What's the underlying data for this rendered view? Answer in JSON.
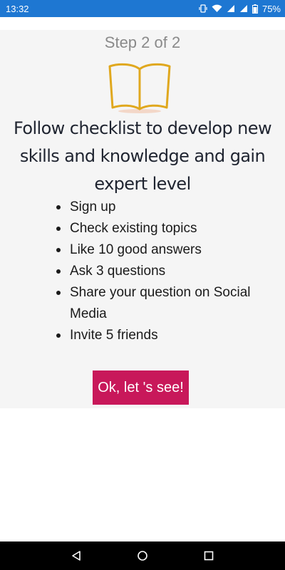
{
  "status_bar": {
    "time": "13:32",
    "battery": "75%",
    "icons": [
      "vibrate-icon",
      "wifi-icon",
      "signal-icon",
      "signal-icon",
      "battery-icon"
    ]
  },
  "onboarding": {
    "step": "Step 2 of 2",
    "illustration": "open-book-icon",
    "headline": "Follow checklist to develop new skills and knowledge and gain expert level",
    "checklist": [
      "Sign up",
      "Check existing topics",
      "Like 10 good answers",
      "Ask 3 questions",
      "Share your question on Social Media",
      "Invite 5 friends"
    ],
    "cta_label": "Ok, let 's see!"
  },
  "nav_bar": {
    "buttons": [
      "back-icon",
      "home-icon",
      "recents-icon"
    ]
  },
  "colors": {
    "status_bar": "#1e77d2",
    "card_bg": "#f5f5f5",
    "cta": "#c8185a",
    "book": "#e0a81e"
  }
}
